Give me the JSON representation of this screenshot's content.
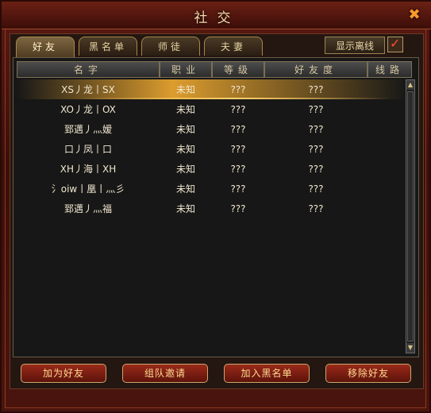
{
  "window": {
    "title": "社交"
  },
  "tabs": [
    {
      "label": "好友",
      "active": true
    },
    {
      "label": "黑名单",
      "active": false
    },
    {
      "label": "师徒",
      "active": false
    },
    {
      "label": "夫妻",
      "active": false
    }
  ],
  "options": {
    "show_offline_label": "显示离线",
    "show_offline_checked": true
  },
  "table": {
    "columns": [
      "名字",
      "职业",
      "等级",
      "好友度",
      "线路"
    ],
    "rows": [
      {
        "name": "XS丿龙丨SX",
        "job": "未知",
        "level": "???",
        "affinity": "???",
        "line": ""
      },
      {
        "name": "XO丿龙丨OX",
        "job": "未知",
        "level": "???",
        "affinity": "???",
        "line": ""
      },
      {
        "name": "郅邁丿灬嫒",
        "job": "未知",
        "level": "???",
        "affinity": "???",
        "line": ""
      },
      {
        "name": "口丿凤丨口",
        "job": "未知",
        "level": "???",
        "affinity": "???",
        "line": ""
      },
      {
        "name": "XH丿海丨XH",
        "job": "未知",
        "level": "???",
        "affinity": "???",
        "line": ""
      },
      {
        "name": "氵oiw丨凰丨灬彡",
        "job": "未知",
        "level": "???",
        "affinity": "???",
        "line": ""
      },
      {
        "name": "郅邁丿灬福",
        "job": "未知",
        "level": "???",
        "affinity": "???",
        "line": ""
      }
    ],
    "selected_row": 0
  },
  "actions": [
    {
      "label": "加为好友"
    },
    {
      "label": "组队邀请"
    },
    {
      "label": "加入黑名单"
    },
    {
      "label": "移除好友"
    }
  ],
  "icons": {
    "close": "close-icon",
    "checkbox_mark": "checkmark-icon",
    "scroll_up": "arrow-up-icon",
    "scroll_down": "arrow-down-icon"
  }
}
